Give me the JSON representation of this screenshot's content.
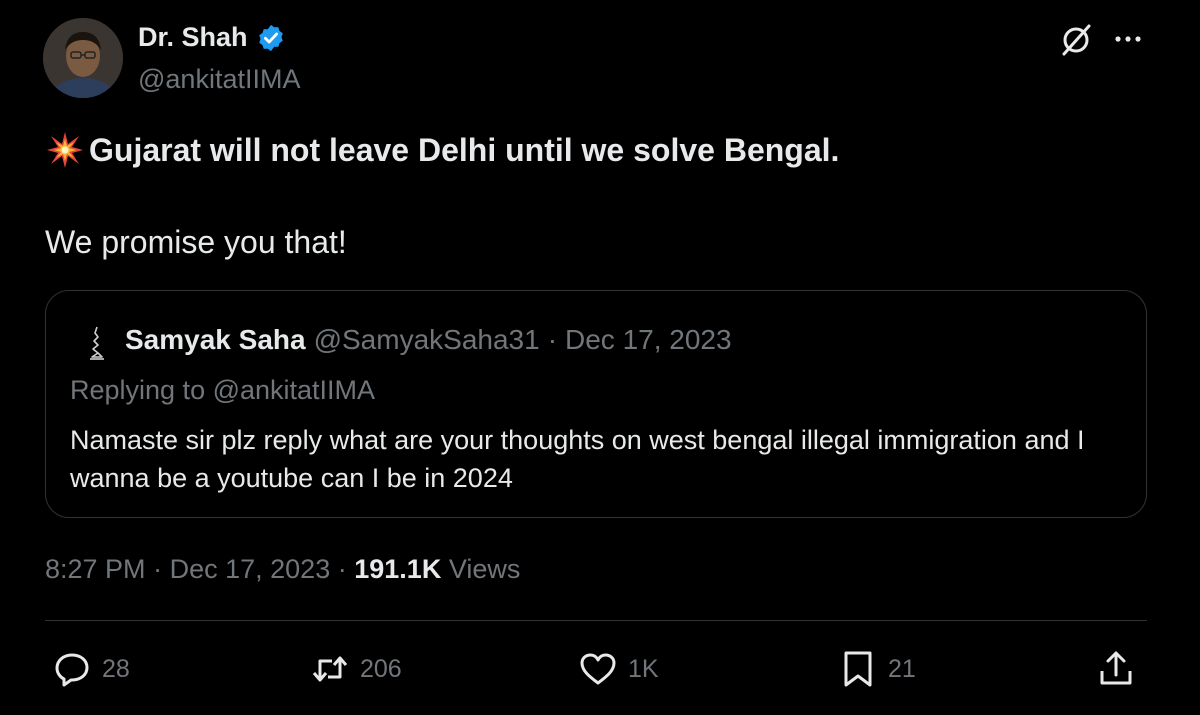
{
  "author": {
    "name": "Dr. Shah",
    "handle": "@ankitatIIMA",
    "verified": true
  },
  "tweet": {
    "line1": "Gujarat will not leave Delhi until we solve Bengal.",
    "line2": "We promise you that!",
    "emoji": "collision-icon"
  },
  "quote": {
    "name": "Samyak Saha",
    "handle": "@SamyakSaha31",
    "separator": "·",
    "date": "Dec 17, 2023",
    "replying_to": "Replying to @ankitatIIMA",
    "text": "Namaste sir plz reply what are your thoughts on west bengal illegal immigration and I wanna be a youtube can I be in 2024"
  },
  "meta": {
    "time": "8:27 PM",
    "separator": "·",
    "date": "Dec 17, 2023",
    "views_count": "191.1K",
    "views_label": "Views"
  },
  "actions": {
    "replies": "28",
    "reposts": "206",
    "likes": "1K",
    "bookmarks": "21"
  },
  "colors": {
    "background": "#000000",
    "text": "#e7e9ea",
    "secondary": "#71767b",
    "border": "#2f3336",
    "verified": "#1d9bf0"
  }
}
